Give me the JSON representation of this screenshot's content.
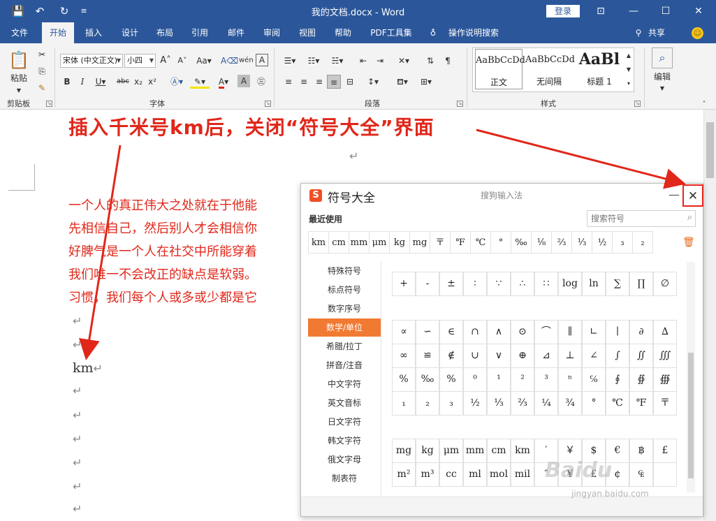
{
  "window": {
    "title": "我的文档.docx  -  Word",
    "login": "登录"
  },
  "tabs": [
    "文件",
    "开始",
    "插入",
    "设计",
    "布局",
    "引用",
    "邮件",
    "审阅",
    "视图",
    "帮助",
    "PDF工具集"
  ],
  "tell_me": "操作说明搜索",
  "share": "共享",
  "ribbon": {
    "clipboard_label": "剪贴板",
    "paste_label": "粘贴",
    "font_label": "字体",
    "paragraph_label": "段落",
    "styles_label": "样式",
    "editing_label": "编辑",
    "font_name": "宋体 (中文正文)",
    "font_size": "小四",
    "styles": [
      {
        "preview": "AaBbCcDd",
        "name": "正文"
      },
      {
        "preview": "AaBbCcDd",
        "name": "无间隔"
      },
      {
        "preview": "AaBl",
        "name": "标题 1"
      }
    ]
  },
  "annotation": "插入千米号km后，关闭“符号大全”界面",
  "document": {
    "lines": [
      "一个人的真正伟大之处就在于他能",
      "先相信自己，然后别人才会相信你",
      "好脾气是一个人在社交中所能穿着",
      "我们唯一不会改正的缺点是软弱。",
      "习惯，我们每个人或多或少都是它"
    ],
    "km": "km"
  },
  "dialog": {
    "title": "符号大全",
    "subtitle": "搜狗输入法",
    "logo": "S",
    "recent_label": "最近使用",
    "search_placeholder": "搜索符号",
    "recent": [
      "km",
      "cm",
      "mm",
      "μm",
      "kg",
      "mg",
      "〒",
      "℉",
      "℃",
      "°",
      "‰",
      "⅛",
      "⅔",
      "⅓",
      "½",
      "₃",
      "₂"
    ],
    "categories": [
      "特殊符号",
      "标点符号",
      "数字序号",
      "数学/单位",
      "希腊/拉丁",
      "拼音/注音",
      "中文字符",
      "英文音标",
      "日文字符",
      "韩文字符",
      "俄文字母",
      "制表符"
    ],
    "active_category": "数学/单位",
    "grid_rows": [
      [
        "+",
        "-",
        "±",
        "∶",
        "∵",
        "∴",
        "∷",
        "log",
        "ln",
        "∑",
        "∏",
        "∅"
      ],
      [
        "∝",
        "∽",
        "∈",
        "∩",
        "∧",
        "⊙",
        "⌒",
        "∥",
        "∟",
        "∣",
        "∂",
        "∆"
      ],
      [
        "∞",
        "≌",
        "∉",
        "∪",
        "∨",
        "⊕",
        "⊿",
        "⊥",
        "∠",
        "∫",
        "∬",
        "∭"
      ],
      [
        "%",
        "‰",
        "%",
        "⁰",
        "¹",
        "²",
        "³",
        "ⁿ",
        "℅",
        "∮",
        "∯",
        "∰"
      ],
      [
        "₁",
        "₂",
        "₃",
        "½",
        "⅓",
        "⅔",
        "¼",
        "¾",
        "°",
        "℃",
        "℉",
        "〒"
      ],
      [
        "mg",
        "kg",
        "μm",
        "mm",
        "cm",
        "km",
        "′",
        "￥",
        "$",
        "€",
        "฿",
        "£"
      ],
      [
        "m²",
        "m³",
        "cc",
        "ml",
        "mol",
        "mil",
        "″",
        "¥",
        "£",
        "¢",
        "₠",
        ""
      ]
    ]
  },
  "watermark": {
    "logo": "Baidu",
    "url": "jingyan.baidu.com"
  }
}
